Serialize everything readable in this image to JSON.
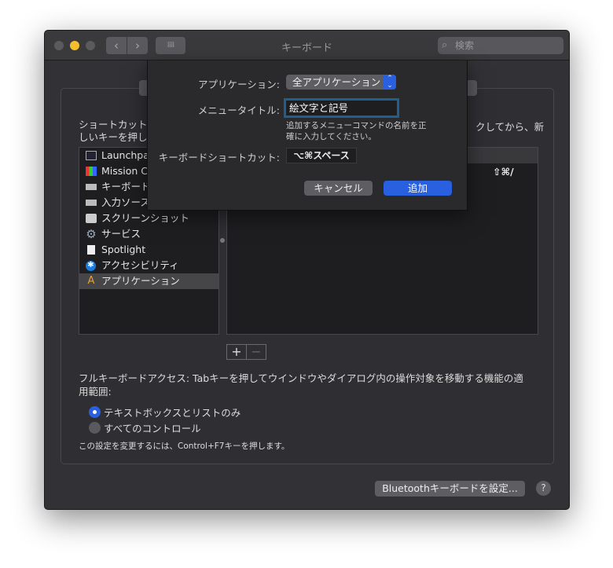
{
  "window": {
    "title": "キーボード",
    "search_placeholder": "検索"
  },
  "description": {
    "line1": "ショートカットを",
    "line1_right": "クしてから、新",
    "line2": "しいキーを押して"
  },
  "categories": [
    {
      "label": "Launchpad",
      "icon": "launchpad-icon"
    },
    {
      "label": "Mission C",
      "icon": "mission-control-icon"
    },
    {
      "label": "キーボード",
      "icon": "keyboard-icon"
    },
    {
      "label": "入力ソース",
      "icon": "keyboard-icon"
    },
    {
      "label": "スクリーンショット",
      "icon": "screenshot-icon"
    },
    {
      "label": "サービス",
      "icon": "gear-icon"
    },
    {
      "label": "Spotlight",
      "icon": "spotlight-icon"
    },
    {
      "label": "アクセシビリティ",
      "icon": "accessibility-icon"
    },
    {
      "label": "アプリケーション",
      "icon": "app-store-icon",
      "selected": true
    }
  ],
  "shortcuts_table": {
    "rows": [
      {
        "shortcut": "⇧⌘/"
      }
    ]
  },
  "add_remove": {
    "add": "+",
    "remove": "−"
  },
  "full_keyboard_access": {
    "text": "フルキーボードアクセス: Tabキーを押してウインドウやダイアログ内の操作対象を移動する機能の適用範囲:",
    "options": [
      {
        "label": "テキストボックスとリストのみ",
        "selected": true
      },
      {
        "label": "すべてのコントロール",
        "selected": false
      }
    ],
    "hint": "この設定を変更するには、Control+F7キーを押します。"
  },
  "bottom": {
    "bluetooth_button": "Bluetoothキーボードを設定...",
    "help": "?"
  },
  "sheet": {
    "app_label": "アプリケーション:",
    "app_value": "全アプリケーション",
    "menu_title_label": "メニュータイトル:",
    "menu_title_value": "絵文字と記号",
    "help_text": "追加するメニューコマンドの名前を正確に入力してください。",
    "shortcut_label": "キーボードショートカット:",
    "shortcut_value": "⌥⌘スペース",
    "cancel": "キャンセル",
    "add": "追加"
  },
  "colors": {
    "accent": "#2860e0",
    "minimize": "#f5be2c"
  }
}
